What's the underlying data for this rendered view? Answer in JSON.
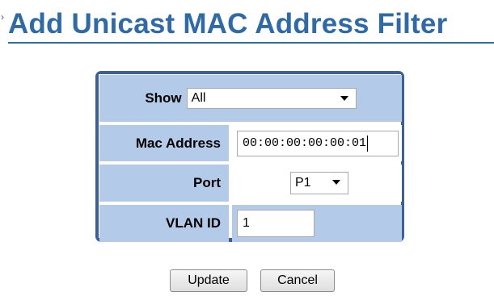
{
  "page": {
    "title": "Add Unicast MAC Address Filter",
    "corner_mark": "›"
  },
  "form": {
    "show": {
      "label": "Show",
      "value": "All"
    },
    "mac_address": {
      "label": "Mac Address",
      "value": "00:00:00:00:00:01"
    },
    "port": {
      "label": "Port",
      "value": "P1"
    },
    "vlan_id": {
      "label": "VLAN ID",
      "value": "1"
    }
  },
  "buttons": {
    "update_label": "Update",
    "cancel_label": "Cancel"
  },
  "colors": {
    "title": "#2e6aa8",
    "frame": "#3c6091",
    "cell_blue": "#b3cbe9"
  }
}
